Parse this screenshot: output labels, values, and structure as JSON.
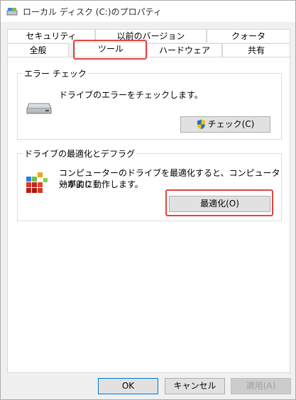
{
  "window": {
    "title": "ローカル ディスク (C:)のプロパティ"
  },
  "tabs": {
    "row1": [
      "セキュリティ",
      "以前のバージョン",
      "クォータ"
    ],
    "row2": [
      "全般",
      "ツール",
      "ハードウェア",
      "共有"
    ],
    "selected": "ツール"
  },
  "error_check": {
    "title": "エラー チェック",
    "description": "ドライブのエラーをチェックします。",
    "button": "チェック(C)"
  },
  "optimize": {
    "title": "ドライブの最適化とデフラグ",
    "description_line1": "コンピューターのドライブを最適化すると、コンピューターがより",
    "description_line2": "効率的に動作します。",
    "button": "最適化(O)"
  },
  "footer": {
    "ok": "OK",
    "cancel": "キャンセル",
    "apply": "適用(A)"
  },
  "colors": {
    "highlight": "#e0453e",
    "focus": "#0078d7",
    "shield_blue": "#1f6fd1",
    "shield_yellow": "#f2c200"
  },
  "icons": {
    "title": "drive-icon",
    "drive": "hard-drive-icon",
    "optimize": "defrag-icon",
    "shield": "uac-shield-icon"
  }
}
